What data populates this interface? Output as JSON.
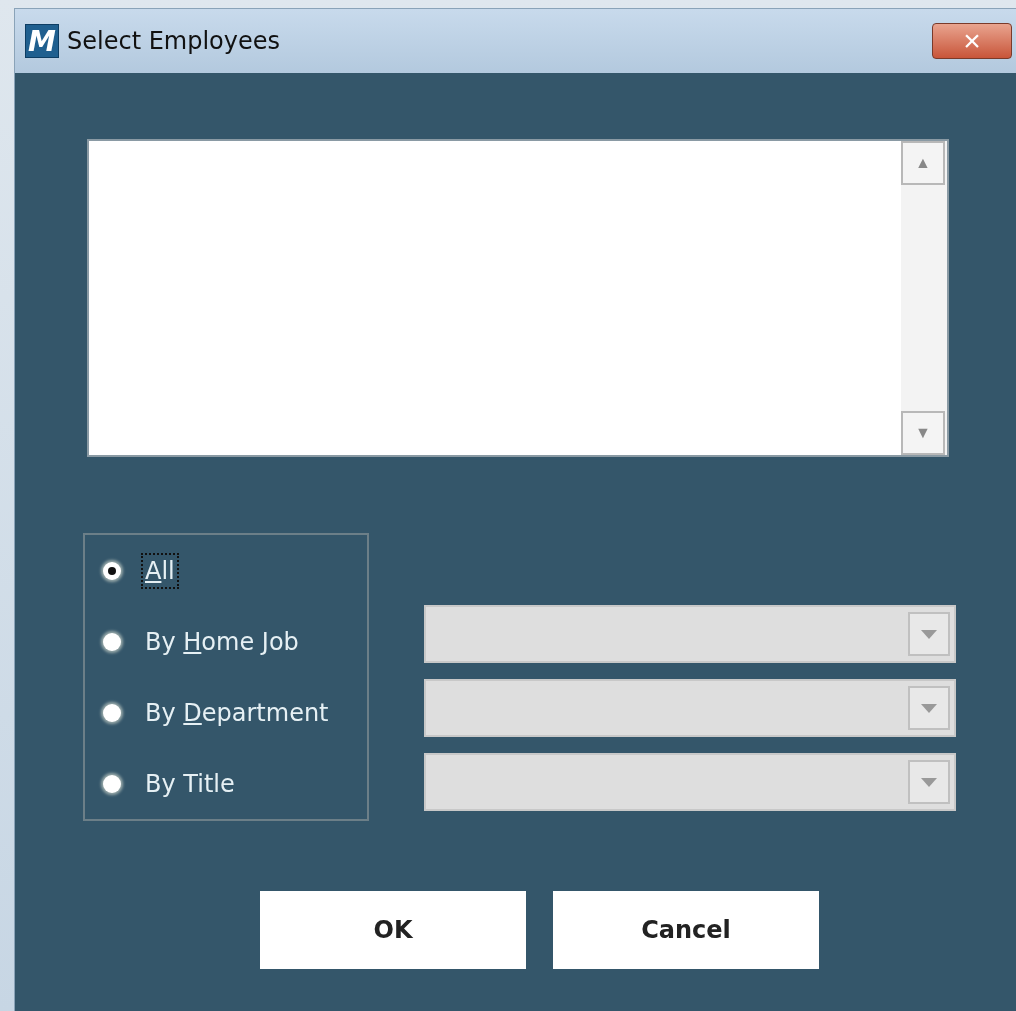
{
  "window": {
    "logo": "M",
    "title": "Select Employees",
    "close": "×"
  },
  "list": {
    "scroll_up": "▲",
    "scroll_down": "▼"
  },
  "filters": [
    {
      "access_key": "A",
      "label_after": "ll",
      "selected": true,
      "focused": true,
      "dropdown": false
    },
    {
      "label_before": "By ",
      "access_key": "H",
      "label_after": "ome Job",
      "selected": false,
      "focused": false,
      "dropdown": true
    },
    {
      "label_before": "By ",
      "access_key": "D",
      "label_after": "epartment",
      "selected": false,
      "focused": false,
      "dropdown": true
    },
    {
      "label_before": "By Title",
      "selected": false,
      "focused": false,
      "dropdown": true
    }
  ],
  "buttons": [
    {
      "label": "OK"
    },
    {
      "label": "Cancel"
    }
  ]
}
